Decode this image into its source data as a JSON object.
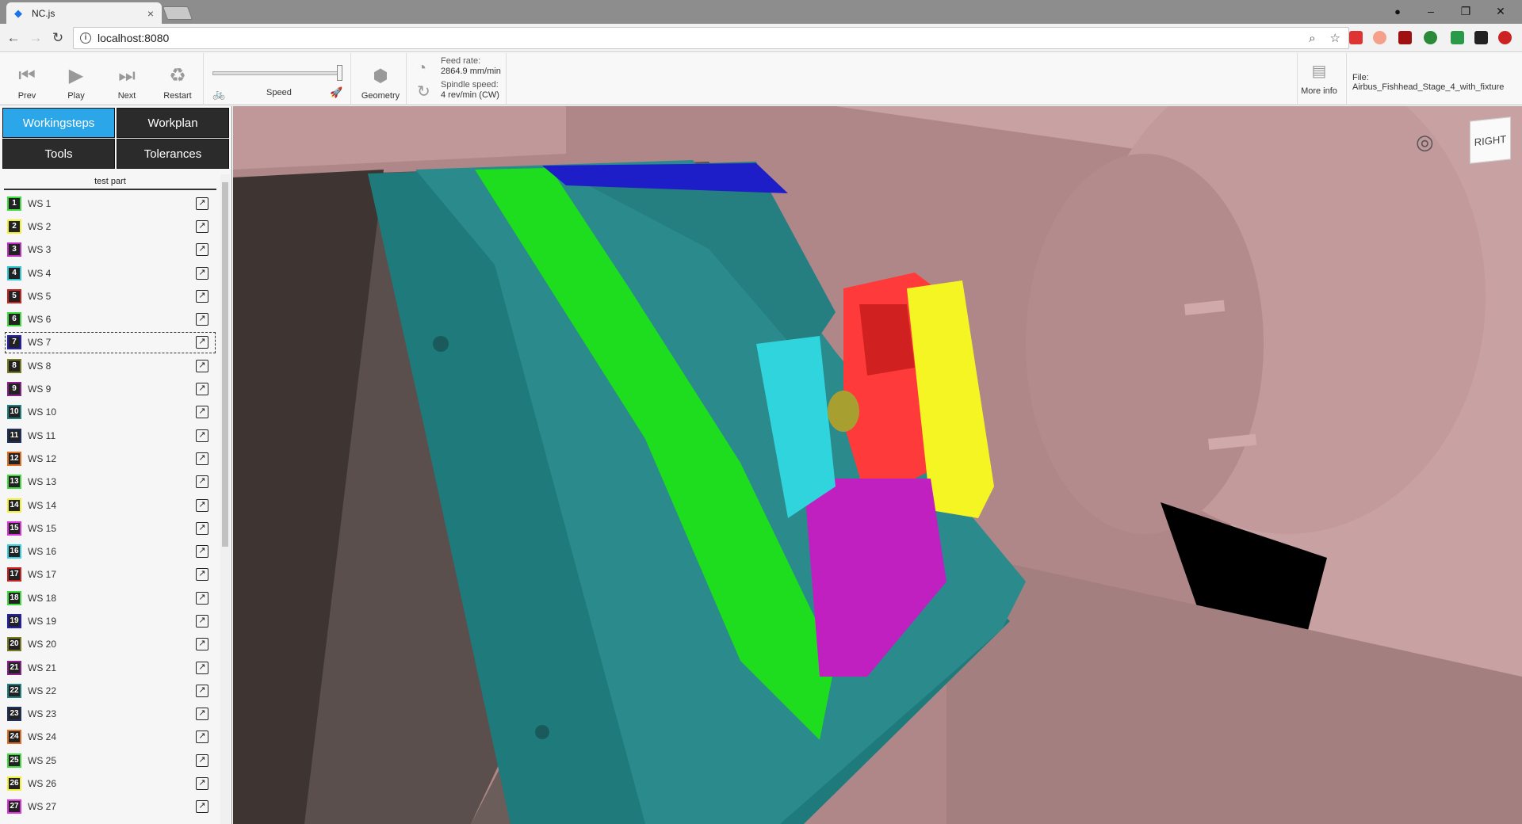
{
  "browser": {
    "tab_title": "NC.js",
    "tab_close": "×",
    "url": "localhost:8080",
    "window_controls": [
      "–",
      "❐",
      "✕"
    ]
  },
  "toolbar": {
    "prev": "Prev",
    "play": "Play",
    "next": "Next",
    "restart": "Restart",
    "speed": "Speed",
    "speed_fraction": 1.0,
    "geometry": "Geometry",
    "feed_label": "Feed rate:",
    "feed_value": "2864.9 mm/min",
    "spindle_label": "Spindle speed:",
    "spindle_value": "4 rev/min (CW)",
    "more_info": "More info",
    "file": "File: Airbus_Fishhead_Stage_4_with_fixture"
  },
  "sidebar": {
    "tabs": [
      "Workingsteps",
      "Workplan",
      "Tools",
      "Tolerances"
    ],
    "active_tab": "Workingsteps",
    "list_header": "test part",
    "selected": 7,
    "items": [
      {
        "n": "1",
        "label": "WS 1",
        "color": "#3ddc3d"
      },
      {
        "n": "2",
        "label": "WS 2",
        "color": "#f0f030"
      },
      {
        "n": "3",
        "label": "WS 3",
        "color": "#c030c0"
      },
      {
        "n": "4",
        "label": "WS 4",
        "color": "#30c8d0"
      },
      {
        "n": "5",
        "label": "WS 5",
        "color": "#d02020"
      },
      {
        "n": "6",
        "label": "WS 6",
        "color": "#3ddc3d"
      },
      {
        "n": "7",
        "label": "WS 7",
        "color": "#2020c0"
      },
      {
        "n": "8",
        "label": "WS 8",
        "color": "#7a7a20"
      },
      {
        "n": "9",
        "label": "WS 9",
        "color": "#8a208a"
      },
      {
        "n": "10",
        "label": "WS 10",
        "color": "#208080"
      },
      {
        "n": "11",
        "label": "WS 11",
        "color": "#203060"
      },
      {
        "n": "12",
        "label": "WS 12",
        "color": "#e07020"
      },
      {
        "n": "13",
        "label": "WS 13",
        "color": "#3ddc3d"
      },
      {
        "n": "14",
        "label": "WS 14",
        "color": "#f0f030"
      },
      {
        "n": "15",
        "label": "WS 15",
        "color": "#e030e0"
      },
      {
        "n": "16",
        "label": "WS 16",
        "color": "#30d0e0"
      },
      {
        "n": "17",
        "label": "WS 17",
        "color": "#d02020"
      },
      {
        "n": "18",
        "label": "WS 18",
        "color": "#3ddc3d"
      },
      {
        "n": "19",
        "label": "WS 19",
        "color": "#2020c0"
      },
      {
        "n": "20",
        "label": "WS 20",
        "color": "#7a7a20"
      },
      {
        "n": "21",
        "label": "WS 21",
        "color": "#8a208a"
      },
      {
        "n": "22",
        "label": "WS 22",
        "color": "#208080"
      },
      {
        "n": "23",
        "label": "WS 23",
        "color": "#203060"
      },
      {
        "n": "24",
        "label": "WS 24",
        "color": "#e07020"
      },
      {
        "n": "25",
        "label": "WS 25",
        "color": "#3ddc3d"
      },
      {
        "n": "26",
        "label": "WS 26",
        "color": "#f0f030"
      },
      {
        "n": "27",
        "label": "WS 27",
        "color": "#e030e0"
      }
    ]
  },
  "viewport": {
    "cube_label": "RIGHT"
  }
}
